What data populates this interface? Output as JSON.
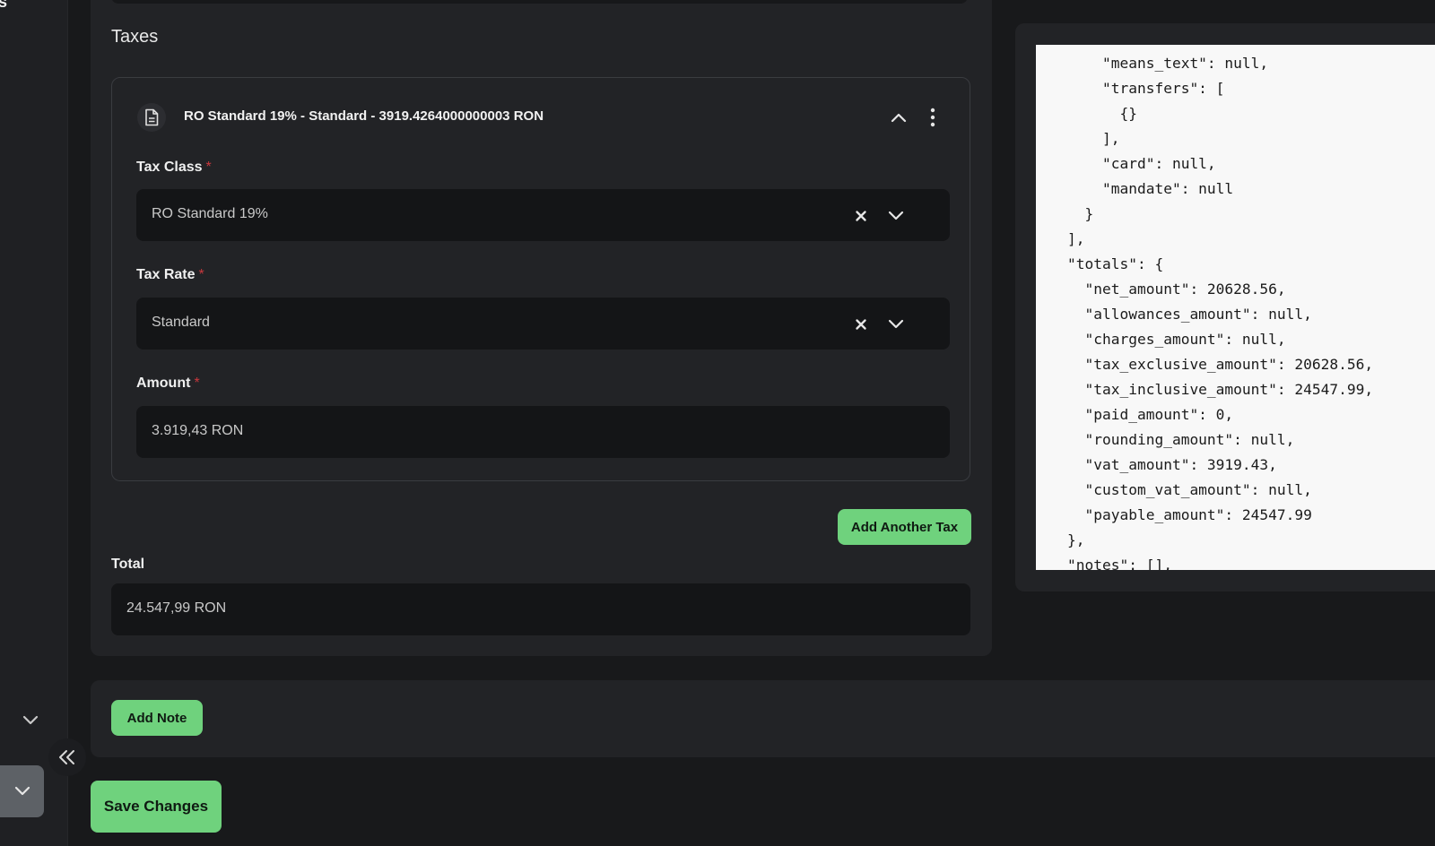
{
  "sidebar": {
    "top_letter": "s"
  },
  "taxes": {
    "section_title": "Taxes",
    "card": {
      "title": "RO Standard 19% - Standard - 3919.4264000000003 RON",
      "tax_class": {
        "label": "Tax Class",
        "required_mark": "*",
        "value": "RO Standard 19%"
      },
      "tax_rate": {
        "label": "Tax Rate",
        "required_mark": "*",
        "value": "Standard"
      },
      "amount": {
        "label": "Amount",
        "required_mark": "*",
        "value": "3.919,43 RON"
      }
    },
    "add_another_tax_label": "Add Another Tax",
    "total": {
      "label": "Total",
      "value": "24.547,99 RON"
    }
  },
  "notes": {
    "add_note_label": "Add Note"
  },
  "footer": {
    "save_label": "Save Changes"
  },
  "json_preview": {
    "text": "    \"means_text\": null,\n    \"transfers\": [\n      {}\n    ],\n    \"card\": null,\n    \"mandate\": null\n  }\n],\n\"totals\": {\n  \"net_amount\": 20628.56,\n  \"allowances_amount\": null,\n  \"charges_amount\": null,\n  \"tax_exclusive_amount\": 20628.56,\n  \"tax_inclusive_amount\": 24547.99,\n  \"paid_amount\": 0,\n  \"rounding_amount\": null,\n  \"vat_amount\": 3919.43,\n  \"custom_vat_amount\": null,\n  \"payable_amount\": 24547.99\n},\n\"notes\": [],"
  },
  "colors": {
    "accent_green": "#6fd27d",
    "required_red": "#c9383d",
    "panel_bg": "#222326",
    "input_bg": "#141517"
  },
  "icons": [
    "document-icon",
    "chevron-up-icon",
    "more-vertical-icon",
    "clear-x-icon",
    "chevron-down-icon",
    "double-chevron-left-icon"
  ]
}
